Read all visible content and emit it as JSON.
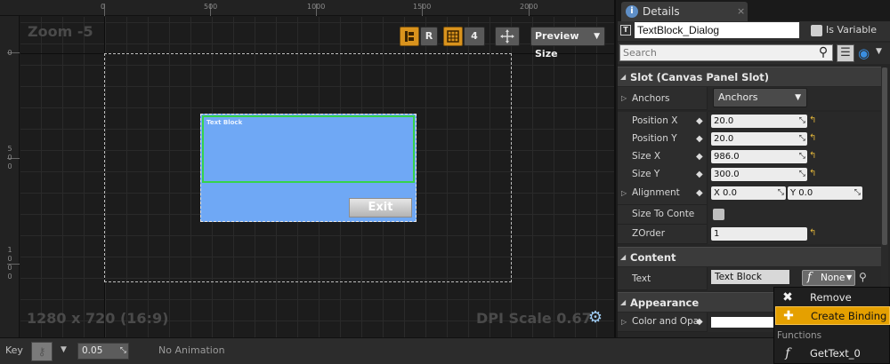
{
  "viewport": {
    "zoom_label": "Zoom -5",
    "size_label": "1280 x 720 (16:9)",
    "dpi_label": "DPI Scale 0.67",
    "ruler_top": [
      "0",
      "500",
      "1000",
      "1500",
      "2000"
    ],
    "ruler_left": [
      [
        "0"
      ],
      [
        "5",
        "0",
        "0"
      ],
      [
        "1",
        "0",
        "0",
        "0"
      ]
    ],
    "toolbar": {
      "r_label": "R",
      "grid_count": "4",
      "preview_size_label": "Preview Size"
    },
    "canvas": {
      "textblock_label": "Text Block",
      "exit_label": "Exit"
    }
  },
  "details": {
    "tab_label": "Details",
    "close_glyph": "×",
    "widget_name": "TextBlock_Dialog",
    "is_variable_label": "Is Variable",
    "search_placeholder": "Search",
    "slot_section": "Slot (Canvas Panel Slot)",
    "anchors": {
      "label": "Anchors",
      "value": "Anchors"
    },
    "position_x": {
      "label": "Position X",
      "value": "20.0"
    },
    "position_y": {
      "label": "Position Y",
      "value": "20.0"
    },
    "size_x": {
      "label": "Size X",
      "value": "986.0"
    },
    "size_y": {
      "label": "Size Y",
      "value": "300.0"
    },
    "alignment": {
      "label": "Alignment",
      "x_value": "X  0.0",
      "y_value": "Y  0.0"
    },
    "size_to_content": {
      "label": "Size To Conte"
    },
    "zorder": {
      "label": "ZOrder",
      "value": "1"
    },
    "content_section": "Content",
    "text_prop": {
      "label": "Text",
      "value": "Text Block",
      "binding_label": "None"
    },
    "appearance_section": "Appearance",
    "color_prop": {
      "label": "Color and Opa"
    }
  },
  "binding_menu": {
    "remove_label": "Remove Binding",
    "create_label": "Create Binding",
    "functions_heading": "Functions",
    "function_items": [
      "GetText_0"
    ]
  },
  "timeline": {
    "key_label": "Key",
    "step_value": "0.05",
    "animation_label": "No Animation"
  },
  "colors": {
    "accent_orange": "#e5a000",
    "canvas_panel_blue": "#6fa8f5",
    "selection_green": "#36d44a",
    "dpi_icon_blue": "#9ecbf2"
  }
}
